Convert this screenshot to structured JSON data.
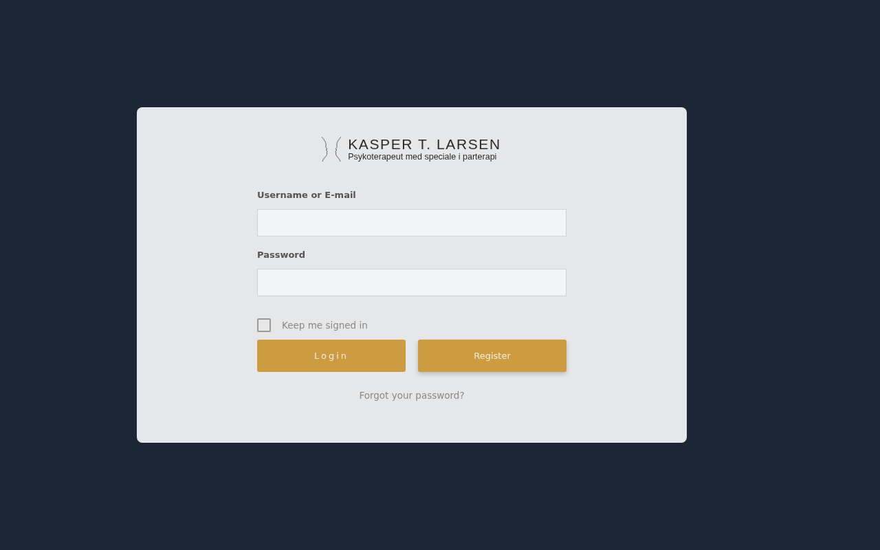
{
  "logo": {
    "title": "KASPER T. LARSEN",
    "subtitle": "Psykoterapeut med speciale i parterapi"
  },
  "fields": [
    {
      "label": "Username or E-mail"
    },
    {
      "label": "Password"
    }
  ],
  "remember": {
    "label": "Keep me signed in",
    "checked": false
  },
  "buttons": [
    {
      "label": "Login",
      "kind": "login",
      "raised": false
    },
    {
      "label": "Register",
      "kind": "register",
      "raised": true
    }
  ],
  "forgot_link": "Forgot your password?"
}
